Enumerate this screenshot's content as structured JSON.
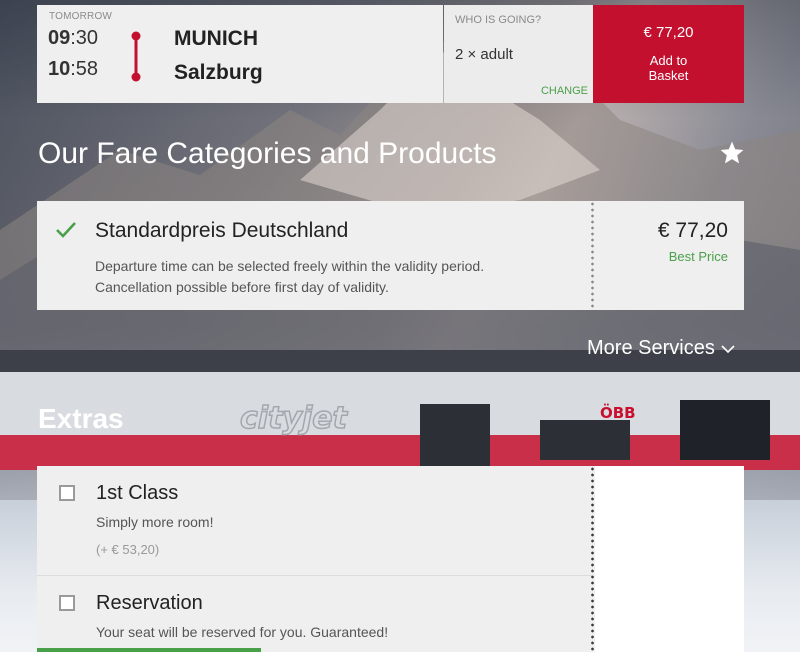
{
  "connection": {
    "day_label": "TOMORROW",
    "departure": {
      "hour": "09",
      "minute": ":30",
      "city": "MUNICH"
    },
    "arrival": {
      "hour": "10",
      "minute": ":58",
      "city": "Salzburg"
    }
  },
  "passengers": {
    "label": "WHO IS GOING?",
    "value": "2 × adult",
    "change_label": "CHANGE"
  },
  "basket": {
    "price": "€ 77,20",
    "label_line1": "Add to",
    "label_line2": "Basket"
  },
  "fare_section": {
    "heading": "Our Fare Categories and Products",
    "fare": {
      "name": "Standardpreis Deutschland",
      "desc_line1": "Departure time can be selected freely within the validity period.",
      "desc_line2": "Cancellation possible before first day of validity.",
      "price": "€ 77,20",
      "badge": "Best Price"
    },
    "more_services": "More Services"
  },
  "extras_section": {
    "heading": "Extras",
    "items": [
      {
        "title": "1st Class",
        "subtitle": "Simply more room!",
        "surcharge": "(+ € 53,20)"
      },
      {
        "title": "Reservation",
        "subtitle": "Your seat will be reserved for you. Guaranteed!"
      }
    ]
  },
  "colors": {
    "brand_red": "#c3102f",
    "accent_green": "#4aa04a"
  },
  "background": {
    "train_brand_text": "cityjet",
    "train_logo_text": "ÖBB"
  }
}
